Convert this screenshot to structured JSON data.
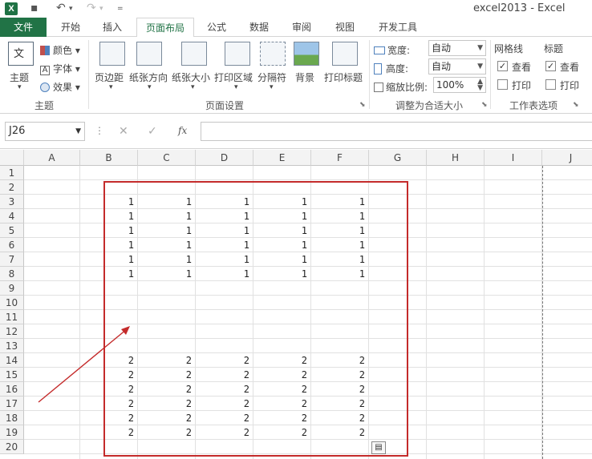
{
  "window": {
    "title": "excel2013 - Excel"
  },
  "tabs": [
    "文件",
    "开始",
    "插入",
    "页面布局",
    "公式",
    "数据",
    "审阅",
    "视图",
    "开发工具"
  ],
  "ribbon": {
    "theme_group": {
      "label": "主题",
      "themes": "主题",
      "colors": "颜色",
      "fonts": "字体",
      "effects": "效果"
    },
    "page_setup_group": {
      "label": "页面设置",
      "margins": "页边距",
      "orientation": "纸张方向",
      "size": "纸张大小",
      "print_area": "打印区域",
      "breaks": "分隔符",
      "background": "背景",
      "print_titles": "打印标题"
    },
    "scale_group": {
      "label": "调整为合适大小",
      "width_label": "宽度:",
      "width_value": "自动",
      "height_label": "高度:",
      "height_value": "自动",
      "scale_label": "缩放比例:",
      "scale_value": "100%"
    },
    "sheet_options_group": {
      "label": "工作表选项",
      "gridlines": "网格线",
      "headings": "标题",
      "view": "查看",
      "print": "打印"
    }
  },
  "formula_bar": {
    "name_box": "J26",
    "fx": "fx"
  },
  "columns": [
    "A",
    "B",
    "C",
    "D",
    "E",
    "F",
    "G",
    "H",
    "I",
    "J"
  ],
  "rows": [
    "1",
    "2",
    "3",
    "4",
    "5",
    "6",
    "7",
    "8",
    "9",
    "10",
    "11",
    "12",
    "13",
    "14",
    "15",
    "16",
    "17",
    "18",
    "19",
    "20"
  ],
  "cells": {
    "r3": [
      "1",
      "1",
      "1",
      "1",
      "1"
    ],
    "r4": [
      "1",
      "1",
      "1",
      "1",
      "1"
    ],
    "r5": [
      "1",
      "1",
      "1",
      "1",
      "1"
    ],
    "r6": [
      "1",
      "1",
      "1",
      "1",
      "1"
    ],
    "r7": [
      "1",
      "1",
      "1",
      "1",
      "1"
    ],
    "r8": [
      "1",
      "1",
      "1",
      "1",
      "1"
    ],
    "r14": [
      "2",
      "2",
      "2",
      "2",
      "2"
    ],
    "r15": [
      "2",
      "2",
      "2",
      "2",
      "2"
    ],
    "r16": [
      "2",
      "2",
      "2",
      "2",
      "2"
    ],
    "r17": [
      "2",
      "2",
      "2",
      "2",
      "2"
    ],
    "r18": [
      "2",
      "2",
      "2",
      "2",
      "2"
    ],
    "r19": [
      "2",
      "2",
      "2",
      "2",
      "2"
    ]
  },
  "colors": {
    "excel_green": "#217346",
    "annotation_red": "#c42b2b"
  }
}
